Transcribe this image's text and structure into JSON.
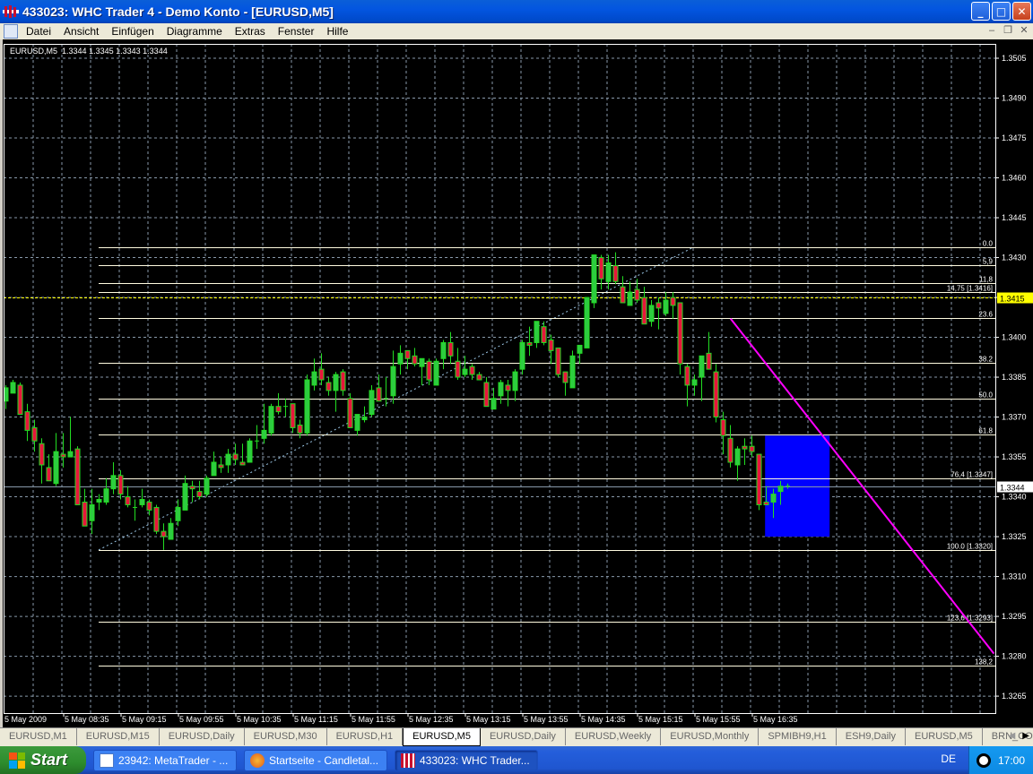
{
  "window": {
    "title": "433023: WHC Trader 4 - Demo Konto - [EURUSD,M5]"
  },
  "menu": [
    "Datei",
    "Ansicht",
    "Einfügen",
    "Diagramme",
    "Extras",
    "Fenster",
    "Hilfe"
  ],
  "chart_info": {
    "symbol": "EURUSD,M5",
    "open": "1.3344",
    "high": "1.3345",
    "low": "1.3343",
    "close": "1.3344"
  },
  "colors": {
    "bull": "#2ecc40",
    "bear": "#e8163c",
    "wick": "#22dd22",
    "grid": "#8899aa",
    "fib": "#fffbe0",
    "trend": "#ff00ff",
    "rect": "#0000ff",
    "hline": "#ffff00",
    "bid": "#8899aa"
  },
  "chart_data": {
    "type": "candlestick",
    "symbol": "EURUSD,M5",
    "ylim": [
      1.3265,
      1.3505
    ],
    "yticks": [
      "1.3505",
      "1.3490",
      "1.3475",
      "1.3460",
      "1.3445",
      "1.3430",
      "1.3415",
      "1.3400",
      "1.3385",
      "1.3370",
      "1.3355",
      "1.3340",
      "1.3325",
      "1.3310",
      "1.3295",
      "1.3280",
      "1.3265"
    ],
    "xlabels": [
      {
        "bar": 0,
        "text": "5 May 2009"
      },
      {
        "bar": 8,
        "text": "5 May 08:35"
      },
      {
        "bar": 16,
        "text": "5 May 09:15"
      },
      {
        "bar": 24,
        "text": "5 May 09:55"
      },
      {
        "bar": 32,
        "text": "5 May 10:35"
      },
      {
        "bar": 40,
        "text": "5 May 11:15"
      },
      {
        "bar": 48,
        "text": "5 May 11:55"
      },
      {
        "bar": 56,
        "text": "5 May 12:35"
      },
      {
        "bar": 64,
        "text": "5 May 13:15"
      },
      {
        "bar": 72,
        "text": "5 May 13:55"
      },
      {
        "bar": 80,
        "text": "5 May 14:35"
      },
      {
        "bar": 88,
        "text": "5 May 15:15"
      },
      {
        "bar": 96,
        "text": "5 May 15:55"
      },
      {
        "bar": 104,
        "text": "5 May 16:35"
      }
    ],
    "ohlc": [
      [
        1.3376,
        1.3382,
        1.3373,
        1.3381
      ],
      [
        1.3379,
        1.3384,
        1.3379,
        1.3383
      ],
      [
        1.3382,
        1.3383,
        1.3371,
        1.3371
      ],
      [
        1.3372,
        1.3375,
        1.3361,
        1.3365
      ],
      [
        1.3366,
        1.3369,
        1.3357,
        1.3361
      ],
      [
        1.336,
        1.3362,
        1.3345,
        1.3352
      ],
      [
        1.3351,
        1.3356,
        1.3346,
        1.3346
      ],
      [
        1.3345,
        1.3364,
        1.3344,
        1.3357
      ],
      [
        1.3356,
        1.3364,
        1.3351,
        1.3355
      ],
      [
        1.3355,
        1.337,
        1.3355,
        1.3357
      ],
      [
        1.3358,
        1.3359,
        1.3337,
        1.3337
      ],
      [
        1.3338,
        1.3343,
        1.3329,
        1.3329
      ],
      [
        1.3331,
        1.3343,
        1.3326,
        1.3337
      ],
      [
        1.3338,
        1.3341,
        1.3335,
        1.3339
      ],
      [
        1.3338,
        1.3347,
        1.3337,
        1.3343
      ],
      [
        1.3343,
        1.3353,
        1.3341,
        1.3348
      ],
      [
        1.3348,
        1.335,
        1.3339,
        1.3341
      ],
      [
        1.334,
        1.3344,
        1.3336,
        1.3337
      ],
      [
        1.3336,
        1.3339,
        1.3331,
        1.3336
      ],
      [
        1.3337,
        1.3343,
        1.3336,
        1.3339
      ],
      [
        1.3338,
        1.3339,
        1.3333,
        1.3335
      ],
      [
        1.3336,
        1.3337,
        1.3326,
        1.3327
      ],
      [
        1.3327,
        1.333,
        1.332,
        1.3325
      ],
      [
        1.3324,
        1.3332,
        1.3324,
        1.333
      ],
      [
        1.3331,
        1.3339,
        1.3329,
        1.3336
      ],
      [
        1.3335,
        1.3348,
        1.3335,
        1.3345
      ],
      [
        1.3344,
        1.3346,
        1.3338,
        1.3343
      ],
      [
        1.3342,
        1.3346,
        1.3339,
        1.334
      ],
      [
        1.3341,
        1.3348,
        1.334,
        1.3347
      ],
      [
        1.3348,
        1.3357,
        1.3348,
        1.3353
      ],
      [
        1.3352,
        1.3355,
        1.3349,
        1.3351
      ],
      [
        1.3352,
        1.3358,
        1.3349,
        1.3356
      ],
      [
        1.3356,
        1.336,
        1.3352,
        1.3354
      ],
      [
        1.3353,
        1.336,
        1.3352,
        1.3352
      ],
      [
        1.3353,
        1.3362,
        1.3353,
        1.3361
      ],
      [
        1.3361,
        1.3367,
        1.3358,
        1.3361
      ],
      [
        1.3362,
        1.3375,
        1.336,
        1.3365
      ],
      [
        1.3364,
        1.3375,
        1.3363,
        1.3374
      ],
      [
        1.3374,
        1.3379,
        1.3371,
        1.3372
      ],
      [
        1.3374,
        1.3377,
        1.337,
        1.3374
      ],
      [
        1.3375,
        1.3375,
        1.3364,
        1.3366
      ],
      [
        1.3367,
        1.3369,
        1.3362,
        1.3364
      ],
      [
        1.3364,
        1.3386,
        1.3363,
        1.3384
      ],
      [
        1.3382,
        1.3392,
        1.338,
        1.3387
      ],
      [
        1.3388,
        1.3394,
        1.3382,
        1.3384
      ],
      [
        1.3383,
        1.3385,
        1.3378,
        1.338
      ],
      [
        1.338,
        1.3387,
        1.3372,
        1.3386
      ],
      [
        1.3387,
        1.3388,
        1.3378,
        1.338
      ],
      [
        1.3377,
        1.3379,
        1.3366,
        1.3366
      ],
      [
        1.3365,
        1.3371,
        1.3363,
        1.3371
      ],
      [
        1.3369,
        1.3374,
        1.3368,
        1.337
      ],
      [
        1.3371,
        1.3382,
        1.337,
        1.338
      ],
      [
        1.3381,
        1.3386,
        1.3376,
        1.3376
      ],
      [
        1.3377,
        1.3385,
        1.3374,
        1.3377
      ],
      [
        1.3378,
        1.3395,
        1.3375,
        1.3389
      ],
      [
        1.339,
        1.3397,
        1.3386,
        1.3394
      ],
      [
        1.3395,
        1.3395,
        1.3388,
        1.3392
      ],
      [
        1.3393,
        1.3396,
        1.3389,
        1.339
      ],
      [
        1.3389,
        1.3392,
        1.3382,
        1.3392
      ],
      [
        1.3391,
        1.3392,
        1.3382,
        1.3384
      ],
      [
        1.3382,
        1.3392,
        1.3382,
        1.3391
      ],
      [
        1.3392,
        1.3399,
        1.3388,
        1.3398
      ],
      [
        1.3398,
        1.3402,
        1.339,
        1.3393
      ],
      [
        1.3391,
        1.3396,
        1.3384,
        1.3385
      ],
      [
        1.3386,
        1.3393,
        1.3385,
        1.3388
      ],
      [
        1.3389,
        1.339,
        1.3384,
        1.3386
      ],
      [
        1.3386,
        1.3387,
        1.3384,
        1.3384
      ],
      [
        1.3383,
        1.3385,
        1.3374,
        1.3374
      ],
      [
        1.3373,
        1.3381,
        1.3373,
        1.3377
      ],
      [
        1.3378,
        1.3384,
        1.3375,
        1.3383
      ],
      [
        1.3382,
        1.3384,
        1.3374,
        1.338
      ],
      [
        1.338,
        1.3388,
        1.3376,
        1.3387
      ],
      [
        1.3388,
        1.3399,
        1.3386,
        1.3398
      ],
      [
        1.3398,
        1.3404,
        1.3393,
        1.3397
      ],
      [
        1.3398,
        1.3406,
        1.3396,
        1.3406
      ],
      [
        1.3404,
        1.3406,
        1.3397,
        1.3398
      ],
      [
        1.3399,
        1.3401,
        1.339,
        1.3395
      ],
      [
        1.3396,
        1.3396,
        1.3385,
        1.3386
      ],
      [
        1.3387,
        1.3387,
        1.3378,
        1.3383
      ],
      [
        1.3381,
        1.3395,
        1.3381,
        1.3393
      ],
      [
        1.3394,
        1.3397,
        1.339,
        1.3397
      ],
      [
        1.3396,
        1.3415,
        1.3396,
        1.3415
      ],
      [
        1.3413,
        1.3431,
        1.3411,
        1.3431
      ],
      [
        1.343,
        1.3431,
        1.3418,
        1.3422
      ],
      [
        1.3421,
        1.3431,
        1.3418,
        1.3428
      ],
      [
        1.3427,
        1.3432,
        1.342,
        1.3421
      ],
      [
        1.3419,
        1.3423,
        1.3413,
        1.3413
      ],
      [
        1.3412,
        1.3421,
        1.3412,
        1.3417
      ],
      [
        1.3418,
        1.3422,
        1.3413,
        1.3414
      ],
      [
        1.3415,
        1.3419,
        1.3405,
        1.3405
      ],
      [
        1.3406,
        1.3414,
        1.3404,
        1.3412
      ],
      [
        1.3413,
        1.3415,
        1.3403,
        1.3411
      ],
      [
        1.3409,
        1.3417,
        1.3408,
        1.3414
      ],
      [
        1.3415,
        1.3417,
        1.3407,
        1.3412
      ],
      [
        1.3413,
        1.3413,
        1.3386,
        1.339
      ],
      [
        1.3389,
        1.339,
        1.3374,
        1.3382
      ],
      [
        1.3382,
        1.3386,
        1.3378,
        1.3384
      ],
      [
        1.3385,
        1.3393,
        1.3376,
        1.3393
      ],
      [
        1.3394,
        1.3402,
        1.3388,
        1.3388
      ],
      [
        1.3387,
        1.339,
        1.3368,
        1.337
      ],
      [
        1.3369,
        1.3372,
        1.3356,
        1.3363
      ],
      [
        1.3362,
        1.3367,
        1.3351,
        1.3353
      ],
      [
        1.3352,
        1.3359,
        1.3346,
        1.3358
      ],
      [
        1.3359,
        1.3362,
        1.3352,
        1.3358
      ],
      [
        1.3359,
        1.3363,
        1.3355,
        1.3357
      ],
      [
        1.3356,
        1.3356,
        1.3335,
        1.3337
      ],
      [
        1.3338,
        1.3344,
        1.3337,
        1.3337
      ],
      [
        1.3338,
        1.3343,
        1.3332,
        1.3341
      ],
      [
        1.3342,
        1.3346,
        1.3337,
        1.3344
      ],
      [
        1.3344,
        1.3345,
        1.3343,
        1.3344
      ]
    ],
    "fibonacci": {
      "price_0": 1.3434,
      "price_100": 1.332,
      "start_bar": 13,
      "end_bar": 96,
      "levels": [
        {
          "level": 0.0,
          "label": "0.0"
        },
        {
          "level": 5.9,
          "label": "5,9"
        },
        {
          "level": 11.8,
          "label": "11,8"
        },
        {
          "level": 14.75,
          "label": "14,75  [1.3416]"
        },
        {
          "level": 23.6,
          "label": "23.6"
        },
        {
          "level": 38.2,
          "label": "38.2"
        },
        {
          "level": 50.0,
          "label": "50.0"
        },
        {
          "level": 61.8,
          "label": "61.8"
        },
        {
          "level": 76.4,
          "label": "76,4 [1.3347]"
        },
        {
          "level": 100.0,
          "label": "100.0  [1.3320]"
        },
        {
          "level": 123.6,
          "label": "123,6  [1.3293]"
        },
        {
          "level": 138.2,
          "label": "138,2"
        }
      ]
    },
    "trendline": {
      "from": {
        "bar": 101.1,
        "price": 1.3407
      },
      "to": {
        "bar": 137.8,
        "price": 1.3281
      }
    },
    "rectangle": {
      "from_bar": 105.9,
      "to_bar": 114.9,
      "top": 1.3363,
      "bottom": 1.3325
    },
    "hline": {
      "price": 1.3415,
      "label": "1.3415"
    },
    "bid": {
      "price": 1.3344,
      "label": "1.3344"
    }
  },
  "tabs": [
    "EURUSD,M1",
    "EURUSD,M15",
    "EURUSD,Daily",
    "EURUSD,M30",
    "EURUSD,H1",
    "EURUSD,M5",
    "EURUSD,Daily",
    "EURUSD,Weekly",
    "EURUSD,Monthly",
    "SPMIBH9,H1",
    "ESH9,Daily",
    "EURUSD,M5",
    "BRN_CONT,D"
  ],
  "active_tab": 5,
  "taskbar": {
    "start": "Start",
    "tasks": [
      "23942: MetaTrader - ...",
      "Startseite - Candletal...",
      "433023: WHC Trader..."
    ],
    "language": "DE",
    "clock": "17:00"
  }
}
